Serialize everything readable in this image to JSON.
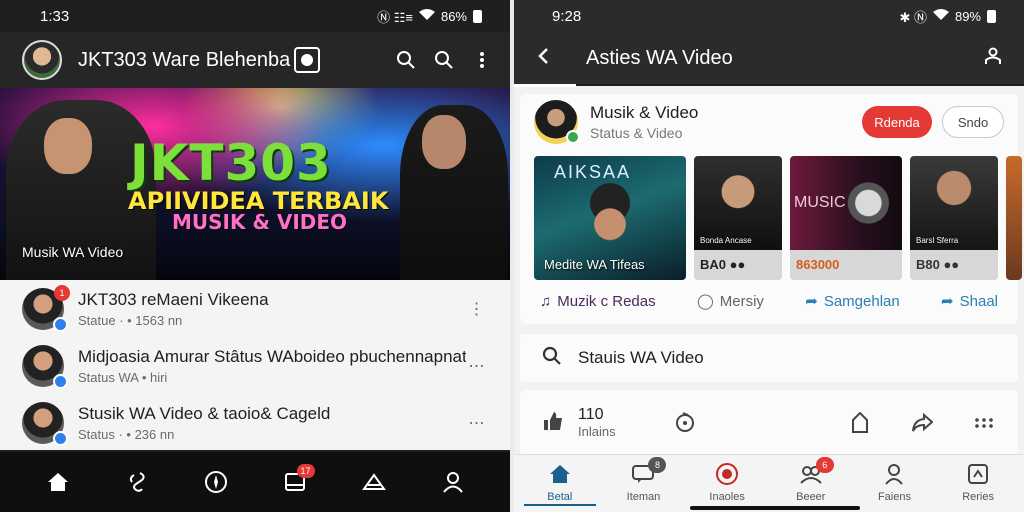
{
  "left": {
    "status": {
      "time": "1:33",
      "icons": "Ⓝ ☷≡",
      "battery": "86%"
    },
    "appbar": {
      "title": "JKT303 Waгe Blehenba"
    },
    "hero": {
      "line1": "JKT303",
      "line2": "APIIVIDEA TERBAIK",
      "line3": "MUSIK & VIDEO",
      "caption": "Musik WA Video"
    },
    "list": [
      {
        "title": "JKT303 reMaeni Vikeena",
        "sub": "Statuе · • 1563 nn",
        "badge": "1"
      },
      {
        "title": "Midjoasia  Amurar Stâtus WAboideo pbuchennapnat.",
        "sub": "Status WA  • hiri",
        "badge": ""
      },
      {
        "title": "Stusik WA Video  & taoio& Cageld",
        "sub": "Status · • 236 nn",
        "badge": ""
      }
    ],
    "nav": {
      "badge": "17"
    }
  },
  "right": {
    "status": {
      "time": "9:28",
      "icons": "✱ Ⓝ",
      "battery": "89%"
    },
    "appbar": {
      "title": "Asties WA Video"
    },
    "channel": {
      "name": "Musik & Video",
      "sub": "Status & Video",
      "primary_btn": "Rdenda",
      "secondary_btn": "Sndo"
    },
    "thumbs": [
      {
        "top": "AIKSAA",
        "caption": "Medite WA Tifeas"
      },
      {
        "mini": "Bonda Ancase",
        "caption": "BA0 ●●"
      },
      {
        "word": "MUSIC",
        "mini": "",
        "caption": "863000"
      },
      {
        "mini": "Barsl Sferra",
        "caption": "B80 ●●"
      }
    ],
    "actions": {
      "a1": "Muzik c Redas",
      "a2": "Mersiy",
      "a3": "Samgehlan",
      "a4": "Shaal"
    },
    "search": {
      "label": "Stauis WA Video"
    },
    "player": {
      "num": "110",
      "sub": "Inlains"
    },
    "nav": [
      {
        "label": "Betal",
        "badge": ""
      },
      {
        "label": "Iteman",
        "badge": "8"
      },
      {
        "label": "Inaoles",
        "badge": ""
      },
      {
        "label": "Beeer",
        "badge": "6"
      },
      {
        "label": "Faiens",
        "badge": ""
      },
      {
        "label": "Reries",
        "badge": ""
      }
    ]
  },
  "colors": {
    "accent_red": "#e53935",
    "accent_blue": "#2a7fb3",
    "verify_blue": "#2f80ed"
  }
}
